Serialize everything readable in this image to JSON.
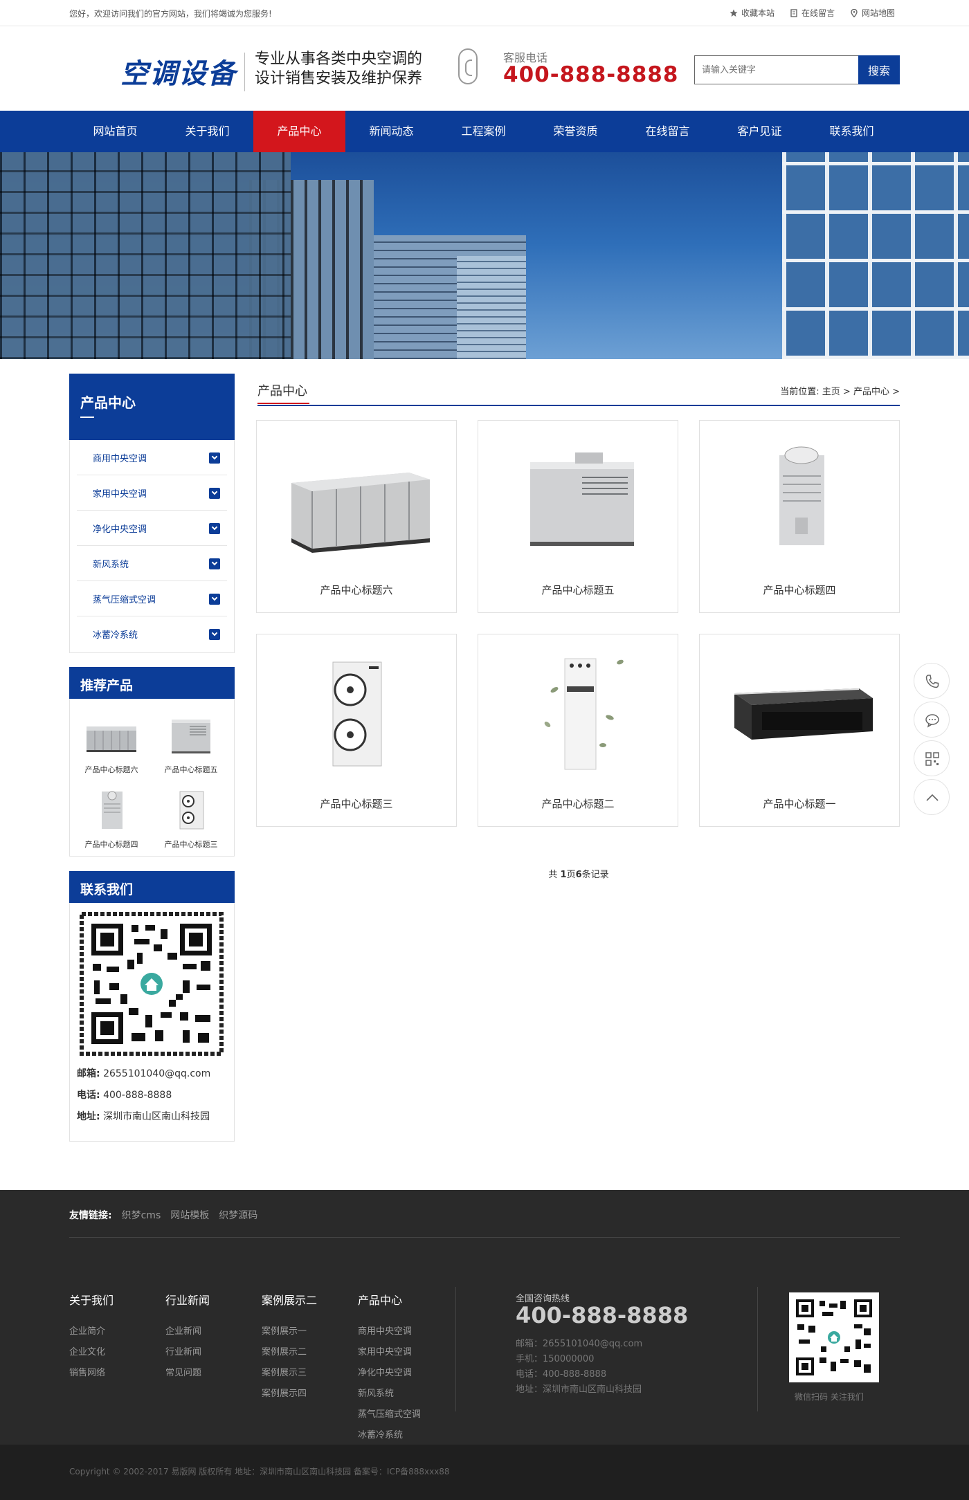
{
  "topbar": {
    "welcome": "您好，欢迎访问我们的官方网站，我们将竭诚为您服务!",
    "links": [
      "收藏本站",
      "在线留言",
      "网站地图"
    ]
  },
  "header": {
    "logo": "空调设备",
    "slogan_line1": "专业从事各类中央空调的",
    "slogan_line2": "设计销售安装及维护保养",
    "hotline_label": "客服电话",
    "hotline": "400-888-8888",
    "search_placeholder": "请输入关键字",
    "search_button": "搜索"
  },
  "nav": {
    "items": [
      "网站首页",
      "关于我们",
      "产品中心",
      "新闻动态",
      "工程案例",
      "荣誉资质",
      "在线留言",
      "客户见证",
      "联系我们"
    ],
    "active": "产品中心"
  },
  "sidebar": {
    "category_title": "产品中心",
    "categories": [
      "商用中央空调",
      "家用中央空调",
      "净化中央空调",
      "新风系统",
      "蒸气压缩式空调",
      "冰蓄冷系统"
    ],
    "recommend_title": "推荐产品",
    "recommend": [
      "产品中心标题六",
      "产品中心标题五",
      "产品中心标题四",
      "产品中心标题三"
    ],
    "contact_title": "联系我们",
    "email_label": "邮箱:",
    "email": "2655101040@qq.com",
    "phone_label": "电话:",
    "phone": "400-888-8888",
    "address_label": "地址:",
    "address": "深圳市南山区南山科技园"
  },
  "main": {
    "title": "产品中心",
    "breadcrumb_prefix": "当前位置:",
    "breadcrumb_home": "主页",
    "breadcrumb_sep": ">",
    "breadcrumb_current": "产品中心",
    "products": [
      "产品中心标题六",
      "产品中心标题五",
      "产品中心标题四",
      "产品中心标题三",
      "产品中心标题二",
      "产品中心标题一"
    ],
    "pager_prefix": "共",
    "pager_pages": "1",
    "pager_mid": "页",
    "pager_count": "6",
    "pager_suffix": "条记录"
  },
  "footer": {
    "friend_label": "友情链接:",
    "friend_links": [
      "织梦cms",
      "网站模板",
      "织梦源码"
    ],
    "col1_title": "关于我们",
    "col1": [
      "企业简介",
      "企业文化",
      "销售网络"
    ],
    "col2_title": "行业新闻",
    "col2": [
      "企业新闻",
      "行业新闻",
      "常见问题"
    ],
    "col3_title": "案例展示二",
    "col3": [
      "案例展示一",
      "案例展示二",
      "案例展示三",
      "案例展示四"
    ],
    "col4_title": "产品中心",
    "col4": [
      "商用中央空调",
      "家用中央空调",
      "净化中央空调",
      "新风系统",
      "蒸气压缩式空调",
      "冰蓄冷系统"
    ],
    "hotline_label": "全国咨询热线",
    "hotline": "400-888-8888",
    "email": "邮箱：2655101040@qq.com",
    "mobile": "手机：150000000",
    "phone": "电话：400-888-8888",
    "address": "地址：深圳市南山区南山科技园",
    "qr_caption": "微信扫码 关注我们",
    "copyright": "Copyright © 2002-2017 易版网 版权所有   地址：深圳市南山区南山科技园   备案号：ICP备888xxx88"
  },
  "colors": {
    "brand_blue": "#0c3d98",
    "accent_red": "#d3161c",
    "footer_bg": "#2a2a2a"
  }
}
